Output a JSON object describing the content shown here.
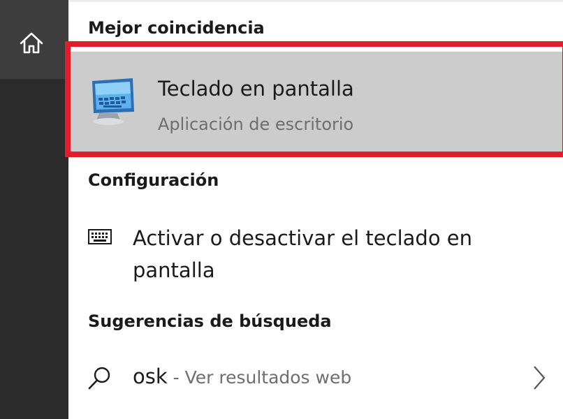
{
  "sidebar": {
    "home_icon": "home-icon"
  },
  "best_match": {
    "section_title": "Mejor coincidencia",
    "app_title": "Teclado en pantalla",
    "app_subtitle": "Aplicación de escritorio",
    "app_icon": "monitor-keyboard-icon",
    "highlight_color": "#e31c2b"
  },
  "settings": {
    "section_title": "Configuración",
    "item_label": "Activar o desactivar el teclado en pantalla",
    "item_icon": "keyboard-icon"
  },
  "suggestions": {
    "section_title": "Sugerencias de búsqueda",
    "query": "osk",
    "hint": " - Ver resultados web",
    "icon": "search-icon",
    "chevron_icon": "chevron-right-icon"
  }
}
